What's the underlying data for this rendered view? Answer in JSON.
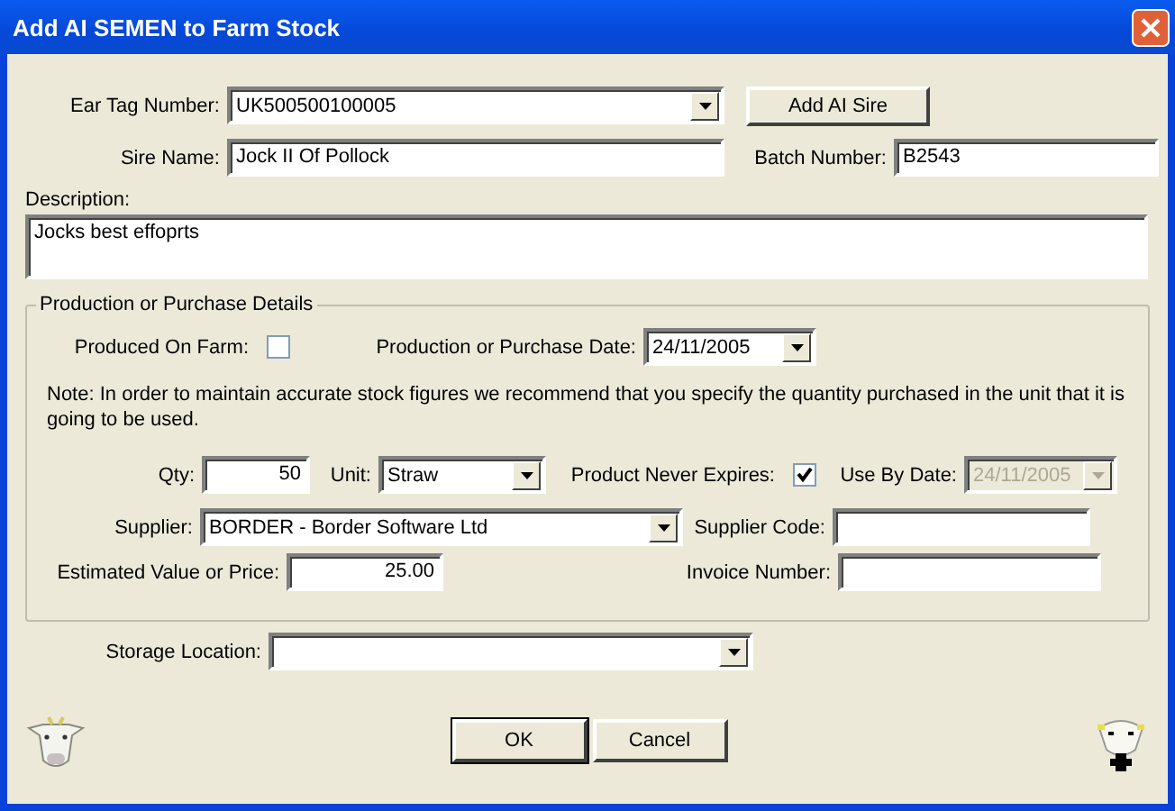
{
  "window": {
    "title": "Add AI SEMEN to Farm Stock"
  },
  "ear_tag": {
    "label": "Ear Tag Number:",
    "value": "UK500500100005"
  },
  "add_sire_button": "Add AI Sire",
  "sire_name": {
    "label": "Sire Name:",
    "value": "Jock II Of Pollock"
  },
  "batch_number": {
    "label": "Batch Number:",
    "value": "B2543"
  },
  "description": {
    "label": "Description:",
    "value": "Jocks best effoprts"
  },
  "details": {
    "legend": "Production or Purchase Details",
    "produced_on_farm": {
      "label": "Produced On Farm:",
      "checked": false
    },
    "date": {
      "label": "Production or Purchase Date:",
      "value": "24/11/2005"
    },
    "note": "Note: In order to maintain accurate stock figures we recommend that you specify the quantity purchased in the unit that it is going to be used.",
    "qty": {
      "label": "Qty:",
      "value": "50"
    },
    "unit": {
      "label": "Unit:",
      "value": "Straw"
    },
    "never_expires": {
      "label": "Product Never Expires:",
      "checked": true
    },
    "use_by": {
      "label": "Use By Date:",
      "value": "24/11/2005",
      "disabled": true
    },
    "supplier": {
      "label": "Supplier:",
      "value": "BORDER - Border Software Ltd"
    },
    "supplier_code": {
      "label": "Supplier Code:"
    },
    "price": {
      "label": "Estimated Value or Price:",
      "value": "25.00"
    },
    "invoice": {
      "label": "Invoice Number:"
    }
  },
  "storage": {
    "label": "Storage Location:"
  },
  "buttons": [
    {
      "label": "OK",
      "default": true
    },
    {
      "label": "Cancel",
      "default": false
    }
  ]
}
